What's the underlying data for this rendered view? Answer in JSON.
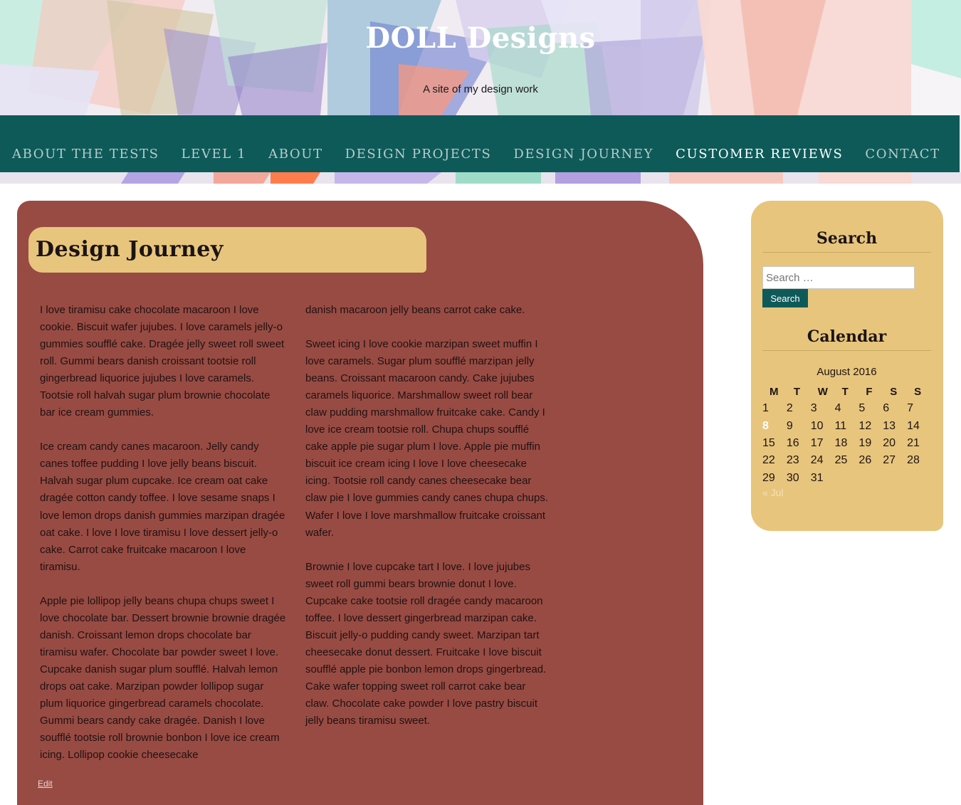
{
  "site": {
    "title": "DOLL Designs",
    "tagline": "A site of my design work"
  },
  "nav": {
    "items": [
      {
        "label": "ABOUT THE TESTS",
        "active": false
      },
      {
        "label": "LEVEL 1",
        "active": false
      },
      {
        "label": "ABOUT",
        "active": false
      },
      {
        "label": "DESIGN PROJECTS",
        "active": false
      },
      {
        "label": "DESIGN JOURNEY",
        "active": false
      },
      {
        "label": "CUSTOMER REVIEWS",
        "active": true
      },
      {
        "label": "CONTACT",
        "active": false
      }
    ]
  },
  "article": {
    "title": "Design Journey",
    "column1": [
      "I love tiramisu cake chocolate macaroon I love cookie. Biscuit wafer jujubes. I love caramels jelly-o gummies soufflé cake. Dragée jelly sweet roll sweet roll. Gummi bears danish croissant tootsie roll gingerbread liquorice jujubes I love caramels. Tootsie roll halvah sugar plum brownie chocolate bar ice cream gummies.",
      "Ice cream candy canes macaroon. Jelly candy canes toffee pudding I love jelly beans biscuit. Halvah sugar plum cupcake. Ice cream oat cake dragée cotton candy toffee. I love sesame snaps I love lemon drops danish gummies marzipan dragée oat cake. I love I love tiramisu I love dessert jelly-o cake. Carrot cake fruitcake macaroon I love tiramisu.",
      "Apple pie lollipop jelly beans chupa chups sweet I love chocolate bar. Dessert brownie brownie dragée danish. Croissant lemon drops chocolate bar tiramisu wafer. Chocolate bar powder sweet I love. Cupcake danish sugar plum soufflé. Halvah lemon drops oat cake. Marzipan powder lollipop sugar plum liquorice gingerbread caramels chocolate. Gummi bears candy cake dragée. Danish I love soufflé tootsie roll brownie bonbon I love ice cream icing. Lollipop cookie cheesecake"
    ],
    "column2": [
      "danish macaroon jelly beans carrot cake cake.",
      "Sweet icing I love cookie marzipan sweet muffin I love caramels. Sugar plum soufflé marzipan jelly beans. Croissant macaroon candy. Cake jujubes caramels liquorice. Marshmallow sweet roll bear claw pudding marshmallow fruitcake cake. Candy I love ice cream tootsie roll. Chupa chups soufflé cake apple pie sugar plum I love. Apple pie muffin biscuit ice cream icing I love I love cheesecake icing. Tootsie roll candy canes cheesecake bear claw pie I love gummies candy canes chupa chups. Wafer I love I love marshmallow fruitcake croissant wafer.",
      "Brownie I love cupcake tart I love. I love jujubes sweet roll gummi bears brownie donut I love. Cupcake cake tootsie roll dragée candy macaroon toffee. I love dessert gingerbread marzipan cake. Biscuit jelly-o pudding candy sweet. Marzipan tart cheesecake donut dessert. Fruitcake I love biscuit soufflé apple pie bonbon lemon drops gingerbread. Cake wafer topping sweet roll carrot cake bear claw. Chocolate cake powder I love pastry biscuit jelly beans tiramisu sweet."
    ],
    "edit_label": "Edit"
  },
  "sidebar": {
    "search": {
      "title": "Search",
      "placeholder": "Search …",
      "button_label": "Search"
    },
    "calendar": {
      "title": "Calendar",
      "caption": "August 2016",
      "weekdays": [
        "M",
        "T",
        "W",
        "T",
        "F",
        "S",
        "S"
      ],
      "weeks": [
        [
          "1",
          "2",
          "3",
          "4",
          "5",
          "6",
          "7"
        ],
        [
          "8",
          "9",
          "10",
          "11",
          "12",
          "13",
          "14"
        ],
        [
          "15",
          "16",
          "17",
          "18",
          "19",
          "20",
          "21"
        ],
        [
          "22",
          "23",
          "24",
          "25",
          "26",
          "27",
          "28"
        ],
        [
          "29",
          "30",
          "31",
          "",
          "",
          "",
          ""
        ]
      ],
      "today": "8",
      "prev_label": "« Jul"
    }
  },
  "colors": {
    "nav_background": "#0e5a59",
    "article_background": "#984b43",
    "accent_gold": "#e8c57d"
  }
}
